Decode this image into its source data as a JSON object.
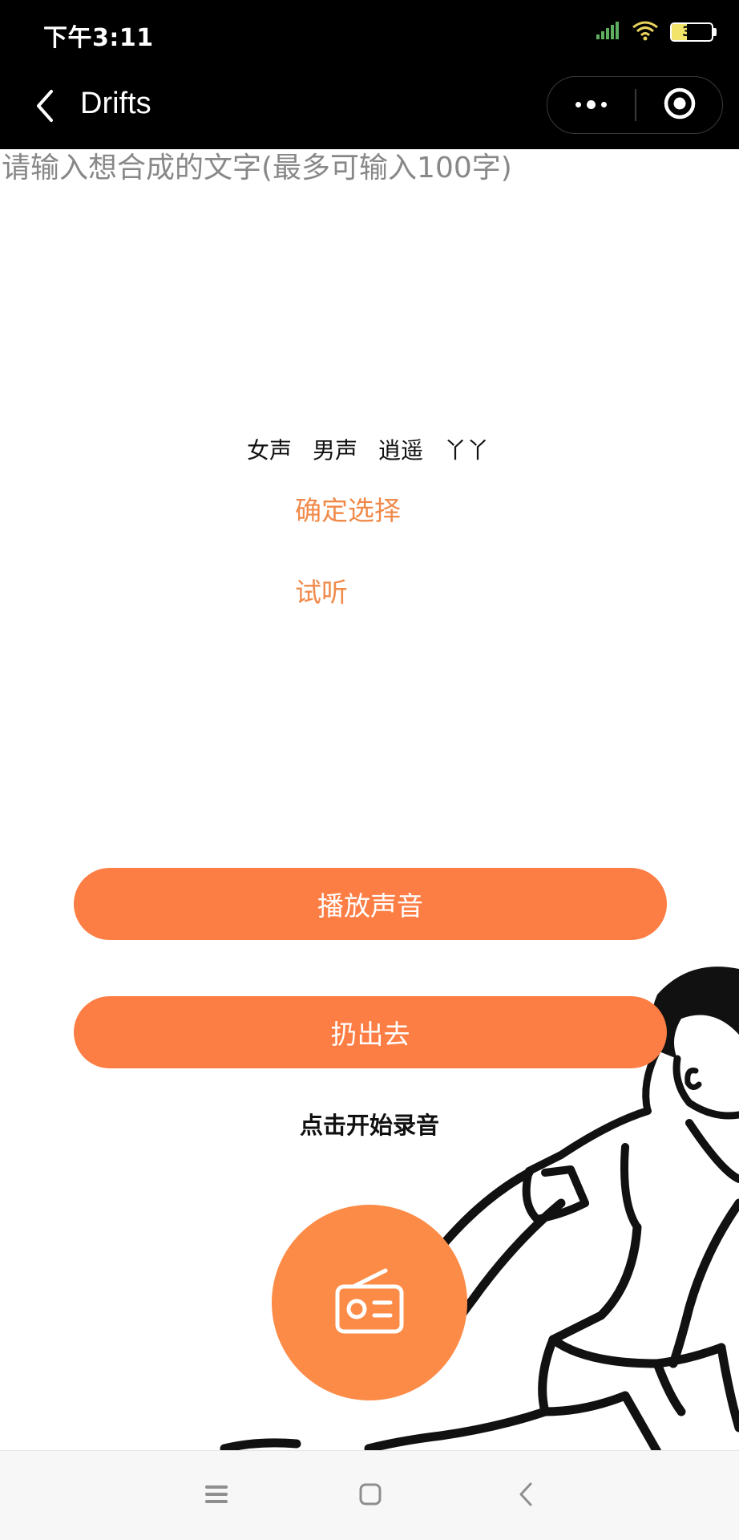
{
  "status_bar": {
    "time": "下午3:11",
    "battery_level": 37,
    "battery_label": "37",
    "icons": [
      "signal-icon",
      "wifi-icon",
      "battery-icon"
    ]
  },
  "nav_bar": {
    "title": "Drifts",
    "back_icon": "chevron-left-icon",
    "more_icon": "more-dots-icon",
    "close_icon": "target-circle-icon"
  },
  "text_input": {
    "value": "",
    "placeholder": "请输入想合成的文字(最多可输入100字)"
  },
  "voice_options": [
    {
      "label": "女声"
    },
    {
      "label": "男声"
    },
    {
      "label": "逍遥"
    },
    {
      "label": "丫丫"
    }
  ],
  "actions": {
    "confirm_label": "确定选择",
    "listen_label": "试听",
    "play_label": "播放声音",
    "throw_label": "扔出去",
    "record_hint": "点击开始录音",
    "record_icon": "radio-icon"
  },
  "colors": {
    "accent": "#fd7e45",
    "link": "#f08a4b",
    "record": "#fd8b48",
    "header": "#000000"
  },
  "system_nav": {
    "icons": [
      "menu-lines-icon",
      "home-square-icon",
      "back-chevron-icon"
    ]
  }
}
